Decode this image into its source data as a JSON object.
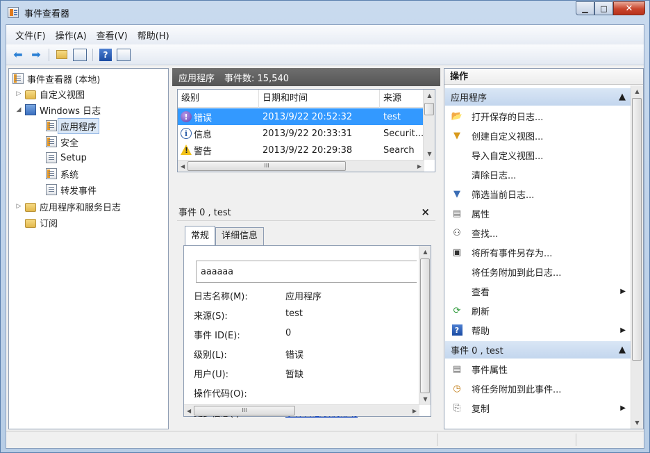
{
  "window": {
    "title": "事件查看器"
  },
  "menu": [
    "文件(F)",
    "操作(A)",
    "查看(V)",
    "帮助(H)"
  ],
  "tree": {
    "root": "事件查看器 (本地)",
    "custom_views": "自定义视图",
    "windows_logs": "Windows 日志",
    "application": "应用程序",
    "security": "安全",
    "setup": "Setup",
    "system": "系统",
    "forwarded": "转发事件",
    "app_service_logs": "应用程序和服务日志",
    "subscriptions": "订阅"
  },
  "middle": {
    "log_name": "应用程序",
    "event_count": "事件数: 15,540",
    "columns": [
      "级别",
      "日期和时间",
      "来源"
    ],
    "rows": [
      {
        "level": "错误",
        "icon": "error",
        "datetime": "2013/9/22 20:52:32",
        "source": "test"
      },
      {
        "level": "信息",
        "icon": "info",
        "datetime": "2013/9/22 20:33:31",
        "source": "Securit..."
      },
      {
        "level": "警告",
        "icon": "warning",
        "datetime": "2013/9/22 20:29:38",
        "source": "Search"
      }
    ],
    "scroll_grip": "III",
    "detail_title": "事件 0 , test",
    "close_glyph": "×",
    "tabs": [
      "常规",
      "详细信息"
    ],
    "message": "aaaaaa",
    "fields": [
      {
        "label": "日志名称(M):",
        "value": "应用程序"
      },
      {
        "label": "来源(S):",
        "value": "test"
      },
      {
        "label": "事件 ID(E):",
        "value": "0"
      },
      {
        "label": "级别(L):",
        "value": "错误"
      },
      {
        "label": "用户(U):",
        "value": "暂缺"
      },
      {
        "label": "操作代码(O):",
        "value": ""
      },
      {
        "label": "更多信息(I):",
        "value": "事件日志联机帮助"
      }
    ]
  },
  "actions": {
    "title": "操作",
    "section1": "应用程序",
    "items1": [
      {
        "label": "打开保存的日志...",
        "icon": "open-folder-icon"
      },
      {
        "label": "创建自定义视图...",
        "icon": "filter-icon"
      },
      {
        "label": "导入自定义视图...",
        "icon": ""
      },
      {
        "label": "清除日志...",
        "icon": ""
      },
      {
        "label": "筛选当前日志...",
        "icon": "filter-icon"
      },
      {
        "label": "属性",
        "icon": "properties-icon"
      },
      {
        "label": "查找...",
        "icon": "find-icon"
      },
      {
        "label": "将所有事件另存为...",
        "icon": "save-icon"
      },
      {
        "label": "将任务附加到此日志...",
        "icon": ""
      },
      {
        "label": "查看",
        "icon": "",
        "submenu": true
      },
      {
        "label": "刷新",
        "icon": "refresh-icon"
      },
      {
        "label": "帮助",
        "icon": "help-icon",
        "submenu": true
      }
    ],
    "section2": "事件 0 , test",
    "items2": [
      {
        "label": "事件属性",
        "icon": "properties-icon"
      },
      {
        "label": "将任务附加到此事件...",
        "icon": "task-icon"
      },
      {
        "label": "复制",
        "icon": "copy-icon",
        "submenu": true
      }
    ]
  },
  "colors": {
    "accent": "#3399ff",
    "section_bg": "#c3d6ee",
    "header_bg": "#555555"
  }
}
